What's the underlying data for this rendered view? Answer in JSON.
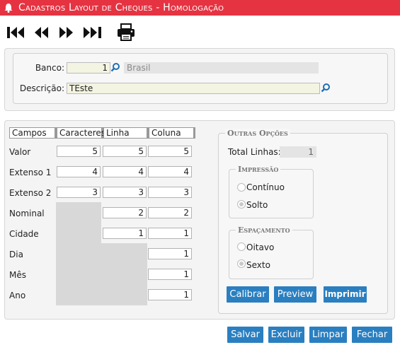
{
  "header": {
    "title": "Cadastros Layout de Cheques  - Homologação"
  },
  "toolbar": {
    "icons": [
      "first-icon",
      "previous-icon",
      "next-icon",
      "last-icon",
      "printer-icon"
    ]
  },
  "form": {
    "banco_label": "Banco:",
    "banco_code": "1",
    "banco_name": "Brasil",
    "descricao_label": "Descrição:",
    "descricao_value": "TEste"
  },
  "table": {
    "headers": [
      "Campos",
      "Caracteres",
      "Linha",
      "Coluna"
    ],
    "rows": [
      {
        "name": "Valor",
        "caracteres": "5",
        "linha": "5",
        "coluna": "5"
      },
      {
        "name": "Extenso 1",
        "caracteres": "4",
        "linha": "4",
        "coluna": "4"
      },
      {
        "name": "Extenso 2",
        "caracteres": "3",
        "linha": "3",
        "coluna": "3"
      },
      {
        "name": "Nominal",
        "linha": "2",
        "coluna": "2"
      },
      {
        "name": "Cidade",
        "linha": "1",
        "coluna": "1"
      },
      {
        "name": "Dia",
        "coluna": "1"
      },
      {
        "name": "Mês",
        "coluna": "1"
      },
      {
        "name": "Ano",
        "coluna": "1"
      }
    ]
  },
  "options": {
    "legend": "Outras Opções",
    "total_linhas_label": "Total Linhas:",
    "total_linhas_value": "1",
    "impressao": {
      "legend": "Impressão",
      "opt1": "Contínuo",
      "opt2": "Solto",
      "selected": "Solto"
    },
    "espacamento": {
      "legend": "Espaçamento",
      "opt1": "Oitavo",
      "opt2": "Sexto",
      "selected": "Sexto"
    },
    "buttons": {
      "calibrar": "Calibrar",
      "preview": "Preview",
      "imprimir": "Imprimir"
    }
  },
  "actions": {
    "salvar": "Salvar",
    "excluir": "Excluir",
    "limpar": "Limpar",
    "fechar": "Fechar"
  },
  "colors": {
    "title_bar": "#e53342",
    "button": "#2a7fc0"
  }
}
